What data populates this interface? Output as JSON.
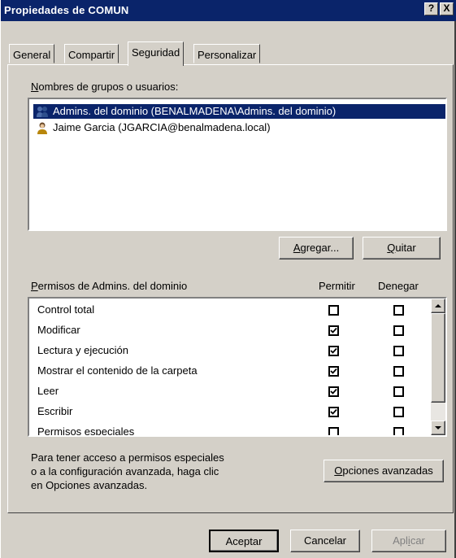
{
  "window": {
    "title": "Propiedades de COMUN",
    "help_label": "?",
    "close_label": "X"
  },
  "tabs": [
    {
      "label": "General"
    },
    {
      "label": "Compartir"
    },
    {
      "label": "Seguridad"
    },
    {
      "label": "Personalizar"
    }
  ],
  "users": {
    "label": "Nombres de grupos o usuarios:",
    "items": [
      {
        "label": "Admins. del dominio (BENALMADENA\\Admins. del dominio)",
        "selected": true,
        "icon": "group-icon"
      },
      {
        "label": "Jaime Garcia (JGARCIA@benalmadena.local)",
        "selected": false,
        "icon": "user-icon"
      }
    ],
    "add_label": "Agregar...",
    "remove_label": "Quitar"
  },
  "permissions": {
    "label": "Permisos de Admins. del dominio",
    "allow_header": "Permitir",
    "deny_header": "Denegar",
    "rows": [
      {
        "name": "Control total",
        "allow": false,
        "deny": false
      },
      {
        "name": "Modificar",
        "allow": true,
        "deny": false
      },
      {
        "name": "Lectura y ejecución",
        "allow": true,
        "deny": false
      },
      {
        "name": "Mostrar el contenido de la carpeta",
        "allow": true,
        "deny": false
      },
      {
        "name": "Leer",
        "allow": true,
        "deny": false
      },
      {
        "name": "Escribir",
        "allow": true,
        "deny": false
      },
      {
        "name": "Permisos especiales",
        "allow": false,
        "deny": false
      }
    ]
  },
  "advanced": {
    "text_line1": "Para tener acceso a permisos especiales",
    "text_line2": "o a la configuración avanzada, haga clic",
    "text_line3": "en Opciones avanzadas.",
    "button_label": "Opciones avanzadas"
  },
  "footer": {
    "ok_label": "Aceptar",
    "cancel_label": "Cancelar",
    "apply_label": "Aplicar"
  }
}
